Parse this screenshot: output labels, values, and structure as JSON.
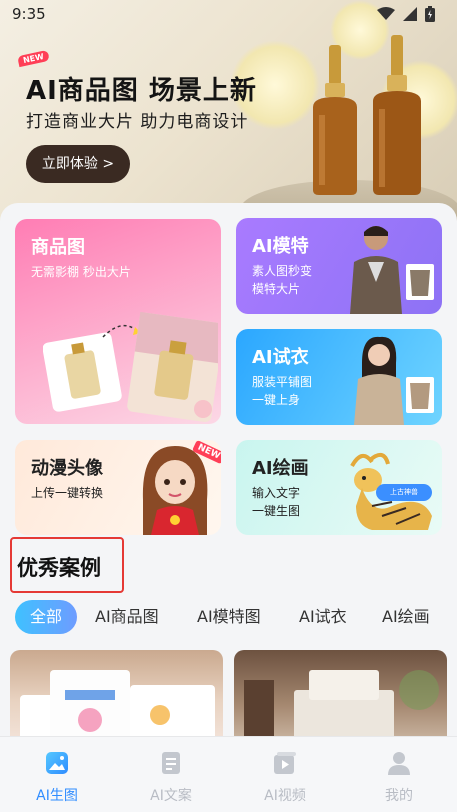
{
  "status_bar": {
    "time": "9:35"
  },
  "banner": {
    "badge": "NEW",
    "title": "AI商品图 场景上新",
    "subtitle": "打造商业大片 助力电商设计",
    "cta_label": "立即体验 >"
  },
  "features": [
    {
      "title": "商品图",
      "desc": "无需影棚 秒出大片"
    },
    {
      "title": "AI模特",
      "desc_line1": "素人图秒变",
      "desc_line2": "模特大片"
    },
    {
      "title": "AI试衣",
      "desc_line1": "服装平铺图",
      "desc_line2": "一键上身"
    },
    {
      "title": "动漫头像",
      "desc": "上传一键转换",
      "badge": "NEW"
    },
    {
      "title": "AI绘画",
      "desc_line1": "输入文字",
      "desc_line2": "一键生图",
      "tag": "上古神兽"
    }
  ],
  "cases_section": {
    "title": "优秀案例",
    "tabs": [
      "全部",
      "AI商品图",
      "AI模特图",
      "AI试衣",
      "AI绘画"
    ],
    "active_tab": 0
  },
  "bottom_nav": [
    {
      "label": "AI生图",
      "icon": "image-icon",
      "active": true
    },
    {
      "label": "AI文案",
      "icon": "document-icon",
      "active": false
    },
    {
      "label": "AI视频",
      "icon": "video-icon",
      "active": false
    },
    {
      "label": "我的",
      "icon": "user-icon",
      "active": false
    }
  ],
  "colors": {
    "accent": "#2f8cff",
    "cta_bg": "#3a2a22",
    "tab_active_start": "#3fc1ff",
    "tab_active_end": "#6e9cff",
    "highlight_border": "#e53935"
  }
}
